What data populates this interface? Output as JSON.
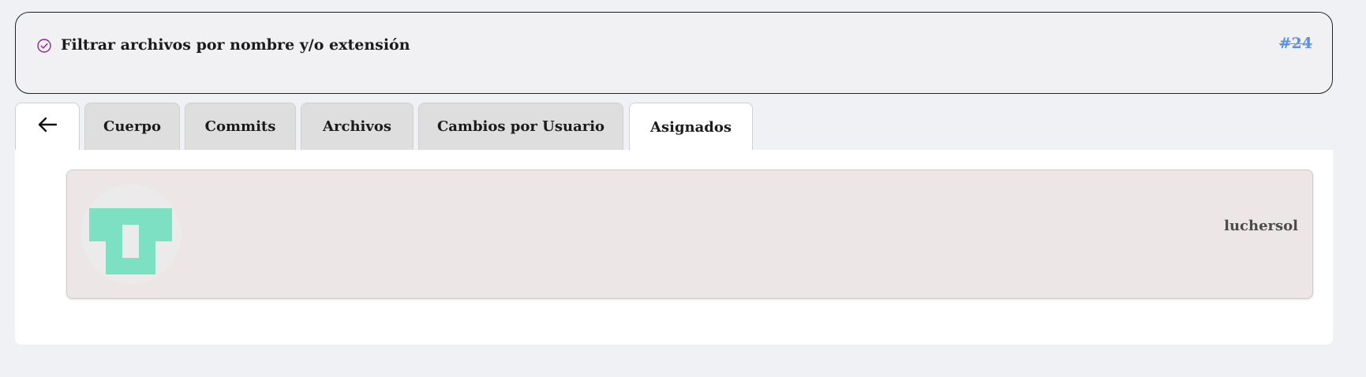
{
  "header": {
    "title": "Filtrar archivos por nombre y/o extensión",
    "number": "#24",
    "status_icon": "check-circle-icon",
    "status_color": "#8e2a8e",
    "number_color": "#5b8fe8"
  },
  "tabs": {
    "back_icon": "arrow-left-icon",
    "items": [
      {
        "label": "Cuerpo",
        "active": false
      },
      {
        "label": "Commits",
        "active": false
      },
      {
        "label": "Archivos",
        "active": false
      },
      {
        "label": "Cambios por Usuario",
        "active": false
      },
      {
        "label": "Asignados",
        "active": true
      }
    ]
  },
  "assignees": [
    {
      "username": "luchersol",
      "avatar_icon": "identicon-avatar",
      "avatar_color": "#7ee0c3"
    }
  ]
}
